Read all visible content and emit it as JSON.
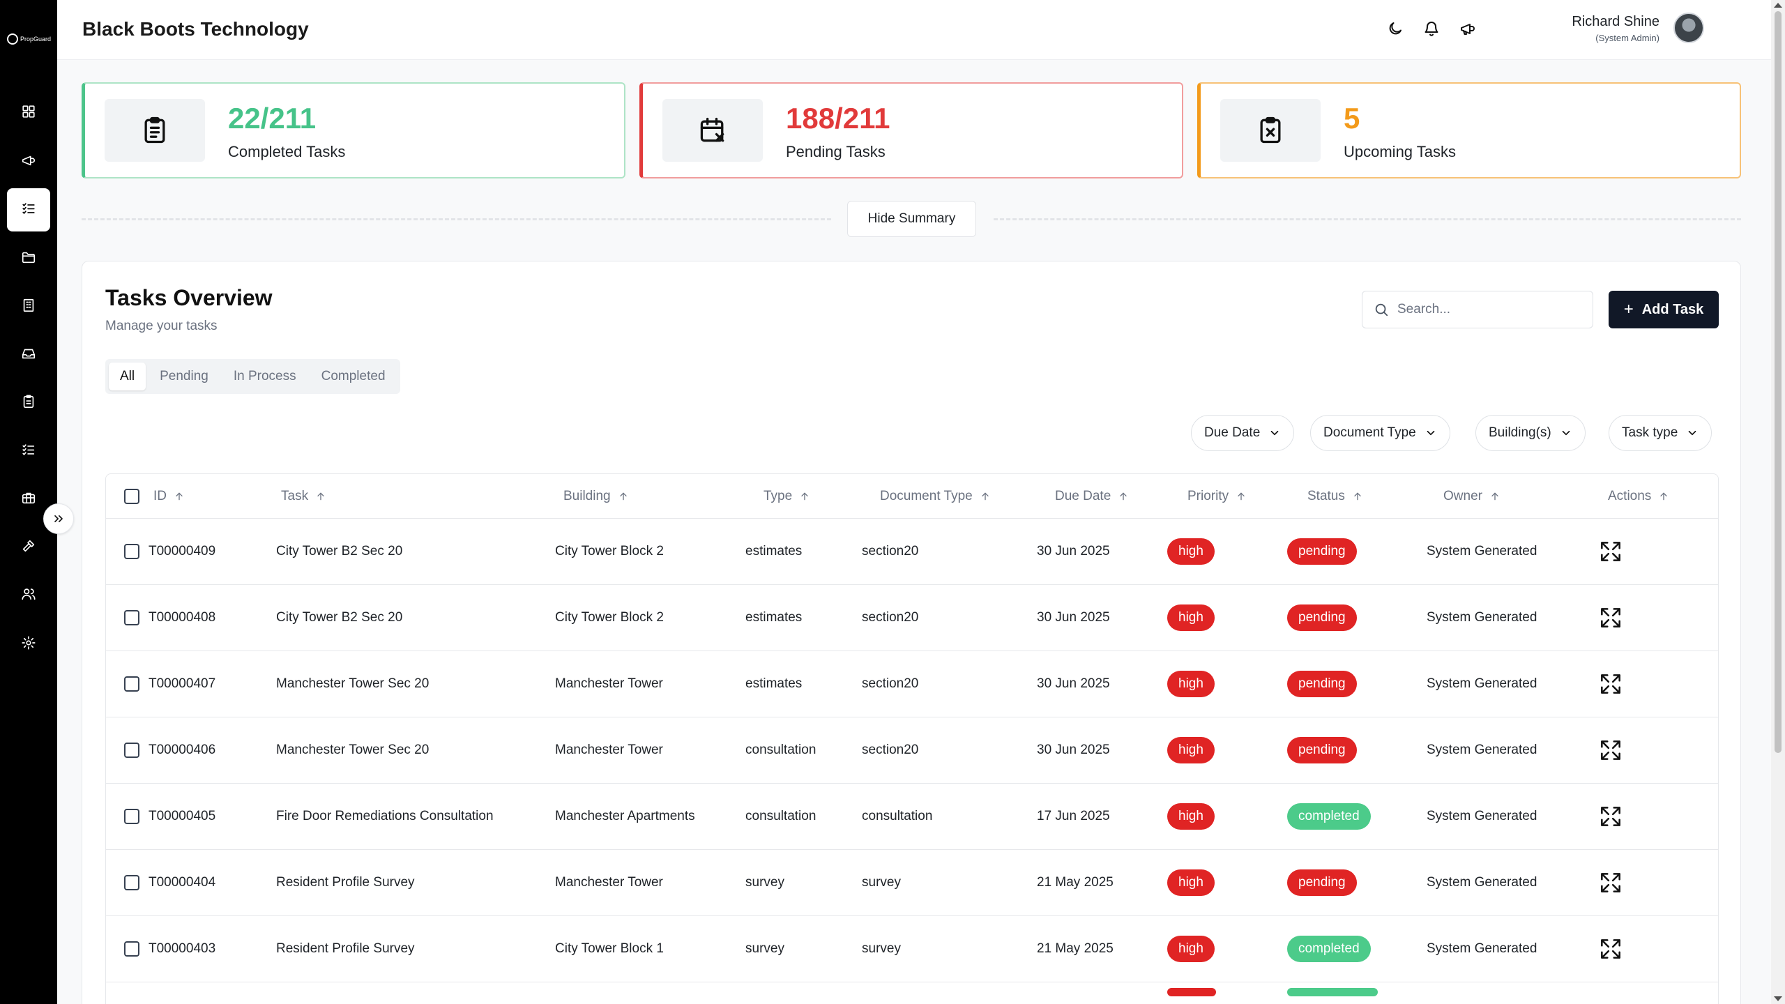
{
  "app": {
    "logo_text": "PropGuard",
    "company": "Black Boots Technology"
  },
  "sidebar": {
    "items": [
      {
        "icon": "dashboard-icon",
        "active": false
      },
      {
        "icon": "megaphone-icon",
        "active": false
      },
      {
        "icon": "task-list-icon",
        "active": true
      },
      {
        "icon": "folder-icon",
        "active": false
      },
      {
        "icon": "building-icon",
        "active": false
      },
      {
        "icon": "inbox-tray-icon",
        "active": false
      },
      {
        "icon": "clipboard-icon",
        "active": false
      },
      {
        "icon": "checklist-icon",
        "active": false
      },
      {
        "icon": "briefcase-icon",
        "active": false
      },
      {
        "icon": "hammer-icon",
        "active": false
      },
      {
        "icon": "users-icon",
        "active": false
      },
      {
        "icon": "settings-icon",
        "active": false
      }
    ]
  },
  "user": {
    "name": "Richard Shine",
    "role": "(System Admin)"
  },
  "summary": {
    "completed": {
      "value": "22/211",
      "label": "Completed Tasks",
      "color": "#46c389"
    },
    "pending": {
      "value": "188/211",
      "label": "Pending Tasks",
      "color": "#e13a3a"
    },
    "upcoming": {
      "value": "5",
      "label": "Upcoming Tasks",
      "color": "#f39a1a"
    },
    "hide_label": "Hide Summary"
  },
  "tasks": {
    "title": "Tasks Overview",
    "subtitle": "Manage your tasks",
    "search_placeholder": "Search...",
    "add_label": "Add Task",
    "tabs": [
      "All",
      "Pending",
      "In Process",
      "Completed"
    ],
    "active_tab": "All",
    "filters": [
      "Due Date",
      "Document Type",
      "Building(s)",
      "Task type"
    ],
    "columns": [
      "ID",
      "Task",
      "Building",
      "Type",
      "Document Type",
      "Due Date",
      "Priority",
      "Status",
      "Owner",
      "Actions"
    ],
    "rows": [
      {
        "id": "T00000409",
        "task": "City Tower B2 Sec 20",
        "building": "City Tower Block 2",
        "type": "estimates",
        "doc_type": "section20",
        "due": "30 Jun 2025",
        "priority": "high",
        "status": "pending",
        "owner": "System Generated"
      },
      {
        "id": "T00000408",
        "task": "City Tower B2 Sec 20",
        "building": "City Tower Block 2",
        "type": "estimates",
        "doc_type": "section20",
        "due": "30 Jun 2025",
        "priority": "high",
        "status": "pending",
        "owner": "System Generated"
      },
      {
        "id": "T00000407",
        "task": "Manchester Tower Sec 20",
        "building": "Manchester Tower",
        "type": "estimates",
        "doc_type": "section20",
        "due": "30 Jun 2025",
        "priority": "high",
        "status": "pending",
        "owner": "System Generated"
      },
      {
        "id": "T00000406",
        "task": "Manchester Tower Sec 20",
        "building": "Manchester Tower",
        "type": "consultation",
        "doc_type": "section20",
        "due": "30 Jun 2025",
        "priority": "high",
        "status": "pending",
        "owner": "System Generated"
      },
      {
        "id": "T00000405",
        "task": "Fire Door Remediations Consultation",
        "building": "Manchester Apartments",
        "type": "consultation",
        "doc_type": "consultation",
        "due": "17 Jun 2025",
        "priority": "high",
        "status": "completed",
        "owner": "System Generated"
      },
      {
        "id": "T00000404",
        "task": "Resident Profile Survey",
        "building": "Manchester Tower",
        "type": "survey",
        "doc_type": "survey",
        "due": "21 May 2025",
        "priority": "high",
        "status": "pending",
        "owner": "System Generated"
      },
      {
        "id": "T00000403",
        "task": "Resident Profile Survey",
        "building": "City Tower Block 1",
        "type": "survey",
        "doc_type": "survey",
        "due": "21 May 2025",
        "priority": "high",
        "status": "completed",
        "owner": "System Generated"
      }
    ]
  }
}
